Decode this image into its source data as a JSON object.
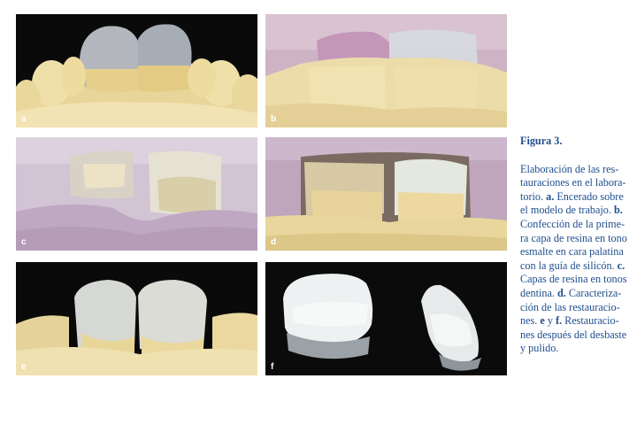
{
  "figure": {
    "title": "Figura 3.",
    "caption_lines": [
      {
        "pre": "Elaboración de las res-"
      },
      {
        "pre": "tauraciones en el labora-"
      },
      {
        "pre": "torio. ",
        "bold": "a.",
        "post": " Encerado sobre"
      },
      {
        "pre": "el modelo de trabajo. ",
        "bold": "b."
      },
      {
        "pre": "Confección de la prime-"
      },
      {
        "pre": "ra capa de resina en tono"
      },
      {
        "pre": "esmalte en cara palatina"
      },
      {
        "pre": "con la guía de silicón. ",
        "bold": "c."
      },
      {
        "pre": "Capas de resina en tonos"
      },
      {
        "pre": "dentina. ",
        "bold": "d.",
        "post": " Caracteriza-"
      },
      {
        "pre": "ción de las restauracio-"
      },
      {
        "pre": "nes. ",
        "bold": "e",
        "post": " y ",
        "bold2": "f.",
        "post2": " Restauracio-"
      },
      {
        "pre": "nes después del desbaste"
      },
      {
        "pre": "y pulido."
      }
    ]
  },
  "panels": {
    "a": {
      "label": "a"
    },
    "b": {
      "label": "b"
    },
    "c": {
      "label": "c"
    },
    "d": {
      "label": "d"
    },
    "e": {
      "label": "e"
    },
    "f": {
      "label": "f"
    }
  },
  "colors": {
    "caption_text": "#1f4e8c",
    "stone_model": "#ecdca8",
    "silicone_guide": "#c9a8bd",
    "photo_background": "#0b0b0b"
  }
}
